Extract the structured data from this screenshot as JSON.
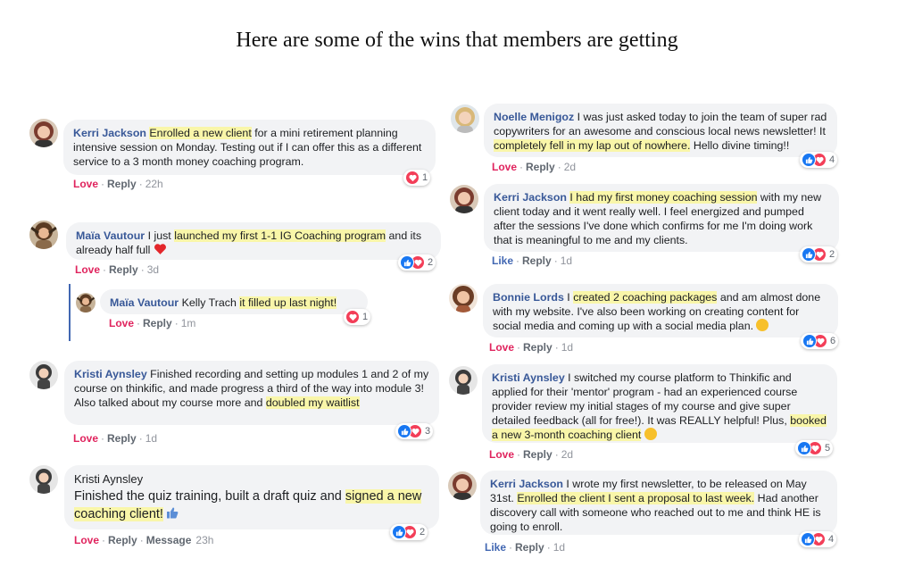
{
  "heading": "Here are some of the wins that members are getting",
  "comments": {
    "c1": {
      "name": "Kerri Jackson",
      "t1": " ",
      "h1": "Enrolled a new client",
      "t2": " for a mini retirement planning intensive session on Monday. Testing out if I can offer this as a different service to a 3 month money coaching program.",
      "a1": "Love",
      "a2": "Reply",
      "time": "22h",
      "count": "1"
    },
    "c2": {
      "name": "Maïa Vautour",
      "t1": " I just ",
      "h1": "launched my first 1-1 IG Coaching program",
      "t2": " and its already half full ",
      "a1": "Love",
      "a2": "Reply",
      "time": "3d",
      "count": "2"
    },
    "c3": {
      "name": "Maïa Vautour",
      "t1": " Kelly Trach ",
      "h1": "it filled up last night!",
      "a1": "Love",
      "a2": "Reply",
      "time": "1m",
      "count": "1"
    },
    "c4": {
      "name": "Kristi Aynsley",
      "t1": " Finished recording and setting up modules 1 and 2 of my course on thinkific, and made progress a third of the way into module 3! Also talked about my course more and ",
      "h1": "doubled my waitlist",
      "a1": "Love",
      "a2": "Reply",
      "time": "1d",
      "count": "3"
    },
    "c5": {
      "name": "Kristi Aynsley",
      "t1": "Finished the quiz training, built a draft quiz and ",
      "h1": "signed a new coaching client!",
      "a1": "Love",
      "a2": "Reply",
      "a3": "Message",
      "time": "23h",
      "count": "2"
    },
    "c6": {
      "name": "Noelle Menigoz",
      "t1": " I was just asked today to join the team of super rad copywriters for an awesome and conscious local news newsletter! It ",
      "h1": "completely fell in my lap out of nowhere.",
      "t2": " Hello divine timing!!",
      "a1": "Love",
      "a2": "Reply",
      "time": "2d",
      "count": "4"
    },
    "c7": {
      "name": "Kerri Jackson",
      "t1": " ",
      "h1": "I had my first money coaching session",
      "t2": " with my new client today and it went really well. I feel energized and pumped after the sessions I've done which confirms for me I'm doing work that is meaningful to me and my clients.",
      "a1": "Like",
      "a2": "Reply",
      "time": "1d",
      "count": "2"
    },
    "c8": {
      "name": "Bonnie Lords",
      "t1": " I ",
      "h1": "created 2 coaching packages",
      "t2": " and am almost done with my website. I've also been working on creating content for social media and coming up with a social media plan. ",
      "a1": "Love",
      "a2": "Reply",
      "time": "1d",
      "count": "6"
    },
    "c9": {
      "name": "Kristi Aynsley",
      "t1": " I switched my course platform to Thinkific and applied for their 'mentor' program - had an experienced course provider review my initial stages of my course and give super detailed feedback (all for free!). It was REALLY helpful! Plus, ",
      "h1": "booked a new 3-month coaching client",
      "t2": " ",
      "a1": "Love",
      "a2": "Reply",
      "time": "2d",
      "count": "5"
    },
    "c10": {
      "name": "Kerri Jackson",
      "t1": " I wrote my first newsletter, to be released on May 31st. ",
      "h1": "Enrolled the client I sent a proposal to last week.",
      "t2": " Had another discovery call with someone who reached out to me and think HE is going to enroll.",
      "a1": "Like",
      "a2": "Reply",
      "time": "1d",
      "count": "4"
    }
  },
  "colors": {
    "highlight": "#f9f6a9",
    "name_blue": "#385898",
    "love_red": "#e0245e",
    "like_blue": "#4267b2",
    "bubble_gray": "#f2f3f5"
  }
}
